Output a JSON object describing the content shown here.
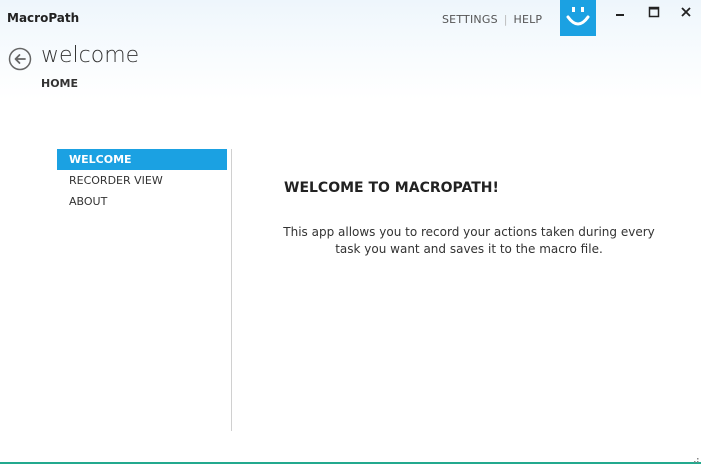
{
  "window": {
    "app_title": "MacroPath",
    "accent_color": "#1ba1e2",
    "bottom_border_color": "#23a98e"
  },
  "header": {
    "links": [
      {
        "label": "SETTINGS"
      },
      {
        "label": "HELP"
      }
    ],
    "logo_icon": "smiley-face-icon",
    "window_controls": [
      "minimize-icon",
      "maximize-icon",
      "close-icon"
    ]
  },
  "page": {
    "back_icon": "back-arrow-circle-icon",
    "title": "welcome",
    "breadcrumb": "HOME"
  },
  "sidebar": {
    "items": [
      {
        "label": "WELCOME",
        "active": true
      },
      {
        "label": "RECORDER VIEW",
        "active": false
      },
      {
        "label": "ABOUT",
        "active": false
      }
    ]
  },
  "main": {
    "heading": "WELCOME TO MACROPATH!",
    "body": "This app allows you to record your actions taken during every task you want and saves it to the macro file."
  }
}
